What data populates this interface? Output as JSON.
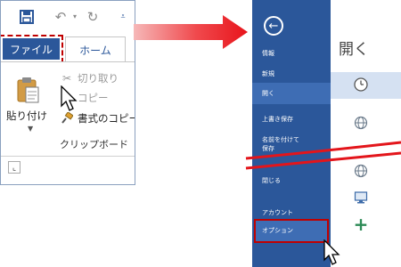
{
  "ribbon": {
    "qat_icons": [
      "save-icon",
      "undo-icon",
      "redo-icon",
      "customize-icon"
    ],
    "tabs": {
      "file": "ファイル",
      "home": "ホーム"
    },
    "clipboard": {
      "paste": "貼り付け",
      "cut": "切り取り",
      "copy": "コピー",
      "format_painter": "書式のコピー",
      "group_label": "クリップボード"
    }
  },
  "backstage": {
    "nav": {
      "info": "情報",
      "new": "新規",
      "open": "開く",
      "save": "上書き保存",
      "save_as_line1": "名前を付けて",
      "save_as_line2": "保存",
      "close": "閉じる",
      "account": "アカウント",
      "options": "オプション"
    },
    "title": "開く",
    "selected_nav": "open"
  },
  "colors": {
    "word_blue": "#2b579a",
    "nav_selected": "#3e6db4",
    "highlight_red": "#c00000",
    "arrow_red": "#e8141b"
  }
}
